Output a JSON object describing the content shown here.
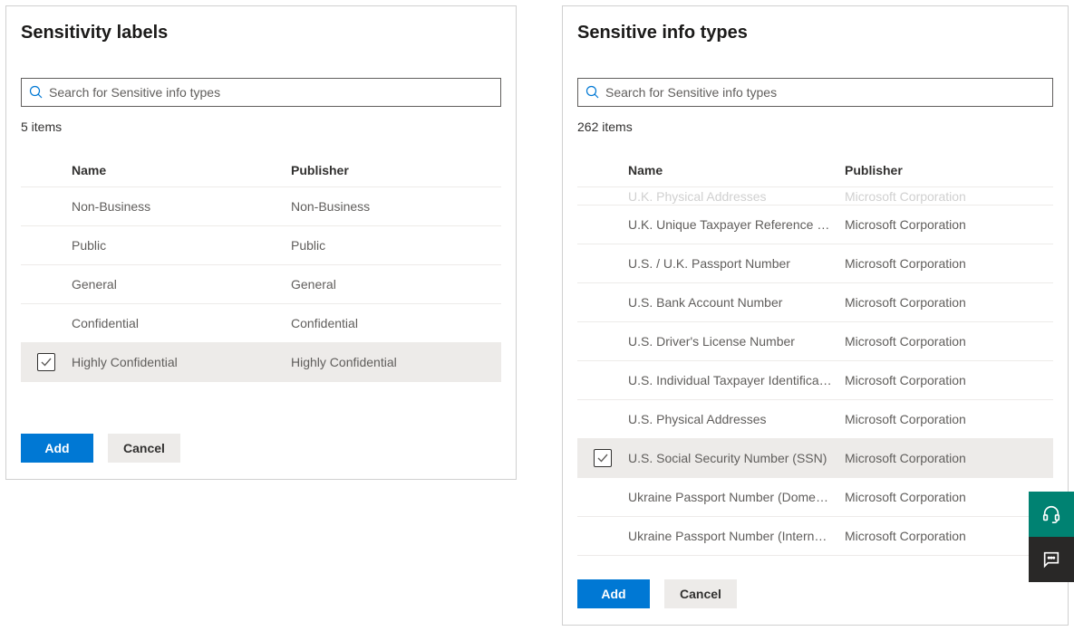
{
  "left": {
    "title": "Sensitivity labels",
    "search_placeholder": "Search for Sensitive info types",
    "items_count": "5 items",
    "columns": {
      "name": "Name",
      "publisher": "Publisher"
    },
    "rows": [
      {
        "name": "Non-Business",
        "publisher": "Non-Business",
        "selected": false
      },
      {
        "name": "Public",
        "publisher": "Public",
        "selected": false
      },
      {
        "name": "General",
        "publisher": "General",
        "selected": false
      },
      {
        "name": "Confidential",
        "publisher": "Confidential",
        "selected": false
      },
      {
        "name": "Highly Confidential",
        "publisher": "Highly Confidential",
        "selected": true
      }
    ],
    "add_label": "Add",
    "cancel_label": "Cancel"
  },
  "right": {
    "title": "Sensitive info types",
    "search_placeholder": "Search for Sensitive info types",
    "items_count": "262 items",
    "columns": {
      "name": "Name",
      "publisher": "Publisher"
    },
    "rows": [
      {
        "name": "U.K. Physical Addresses",
        "publisher": "Microsoft Corporation",
        "selected": false,
        "partial": true
      },
      {
        "name": "U.K. Unique Taxpayer Reference Number",
        "publisher": "Microsoft Corporation",
        "selected": false
      },
      {
        "name": "U.S. / U.K. Passport Number",
        "publisher": "Microsoft Corporation",
        "selected": false
      },
      {
        "name": "U.S. Bank Account Number",
        "publisher": "Microsoft Corporation",
        "selected": false
      },
      {
        "name": "U.S. Driver's License Number",
        "publisher": "Microsoft Corporation",
        "selected": false
      },
      {
        "name": "U.S. Individual Taxpayer Identification N...",
        "publisher": "Microsoft Corporation",
        "selected": false
      },
      {
        "name": "U.S. Physical Addresses",
        "publisher": "Microsoft Corporation",
        "selected": false
      },
      {
        "name": "U.S. Social Security Number (SSN)",
        "publisher": "Microsoft Corporation",
        "selected": true
      },
      {
        "name": "Ukraine Passport Number (Domestic)",
        "publisher": "Microsoft Corporation",
        "selected": false
      },
      {
        "name": "Ukraine Passport Number (International)",
        "publisher": "Microsoft Corporation",
        "selected": false
      }
    ],
    "add_label": "Add",
    "cancel_label": "Cancel"
  }
}
